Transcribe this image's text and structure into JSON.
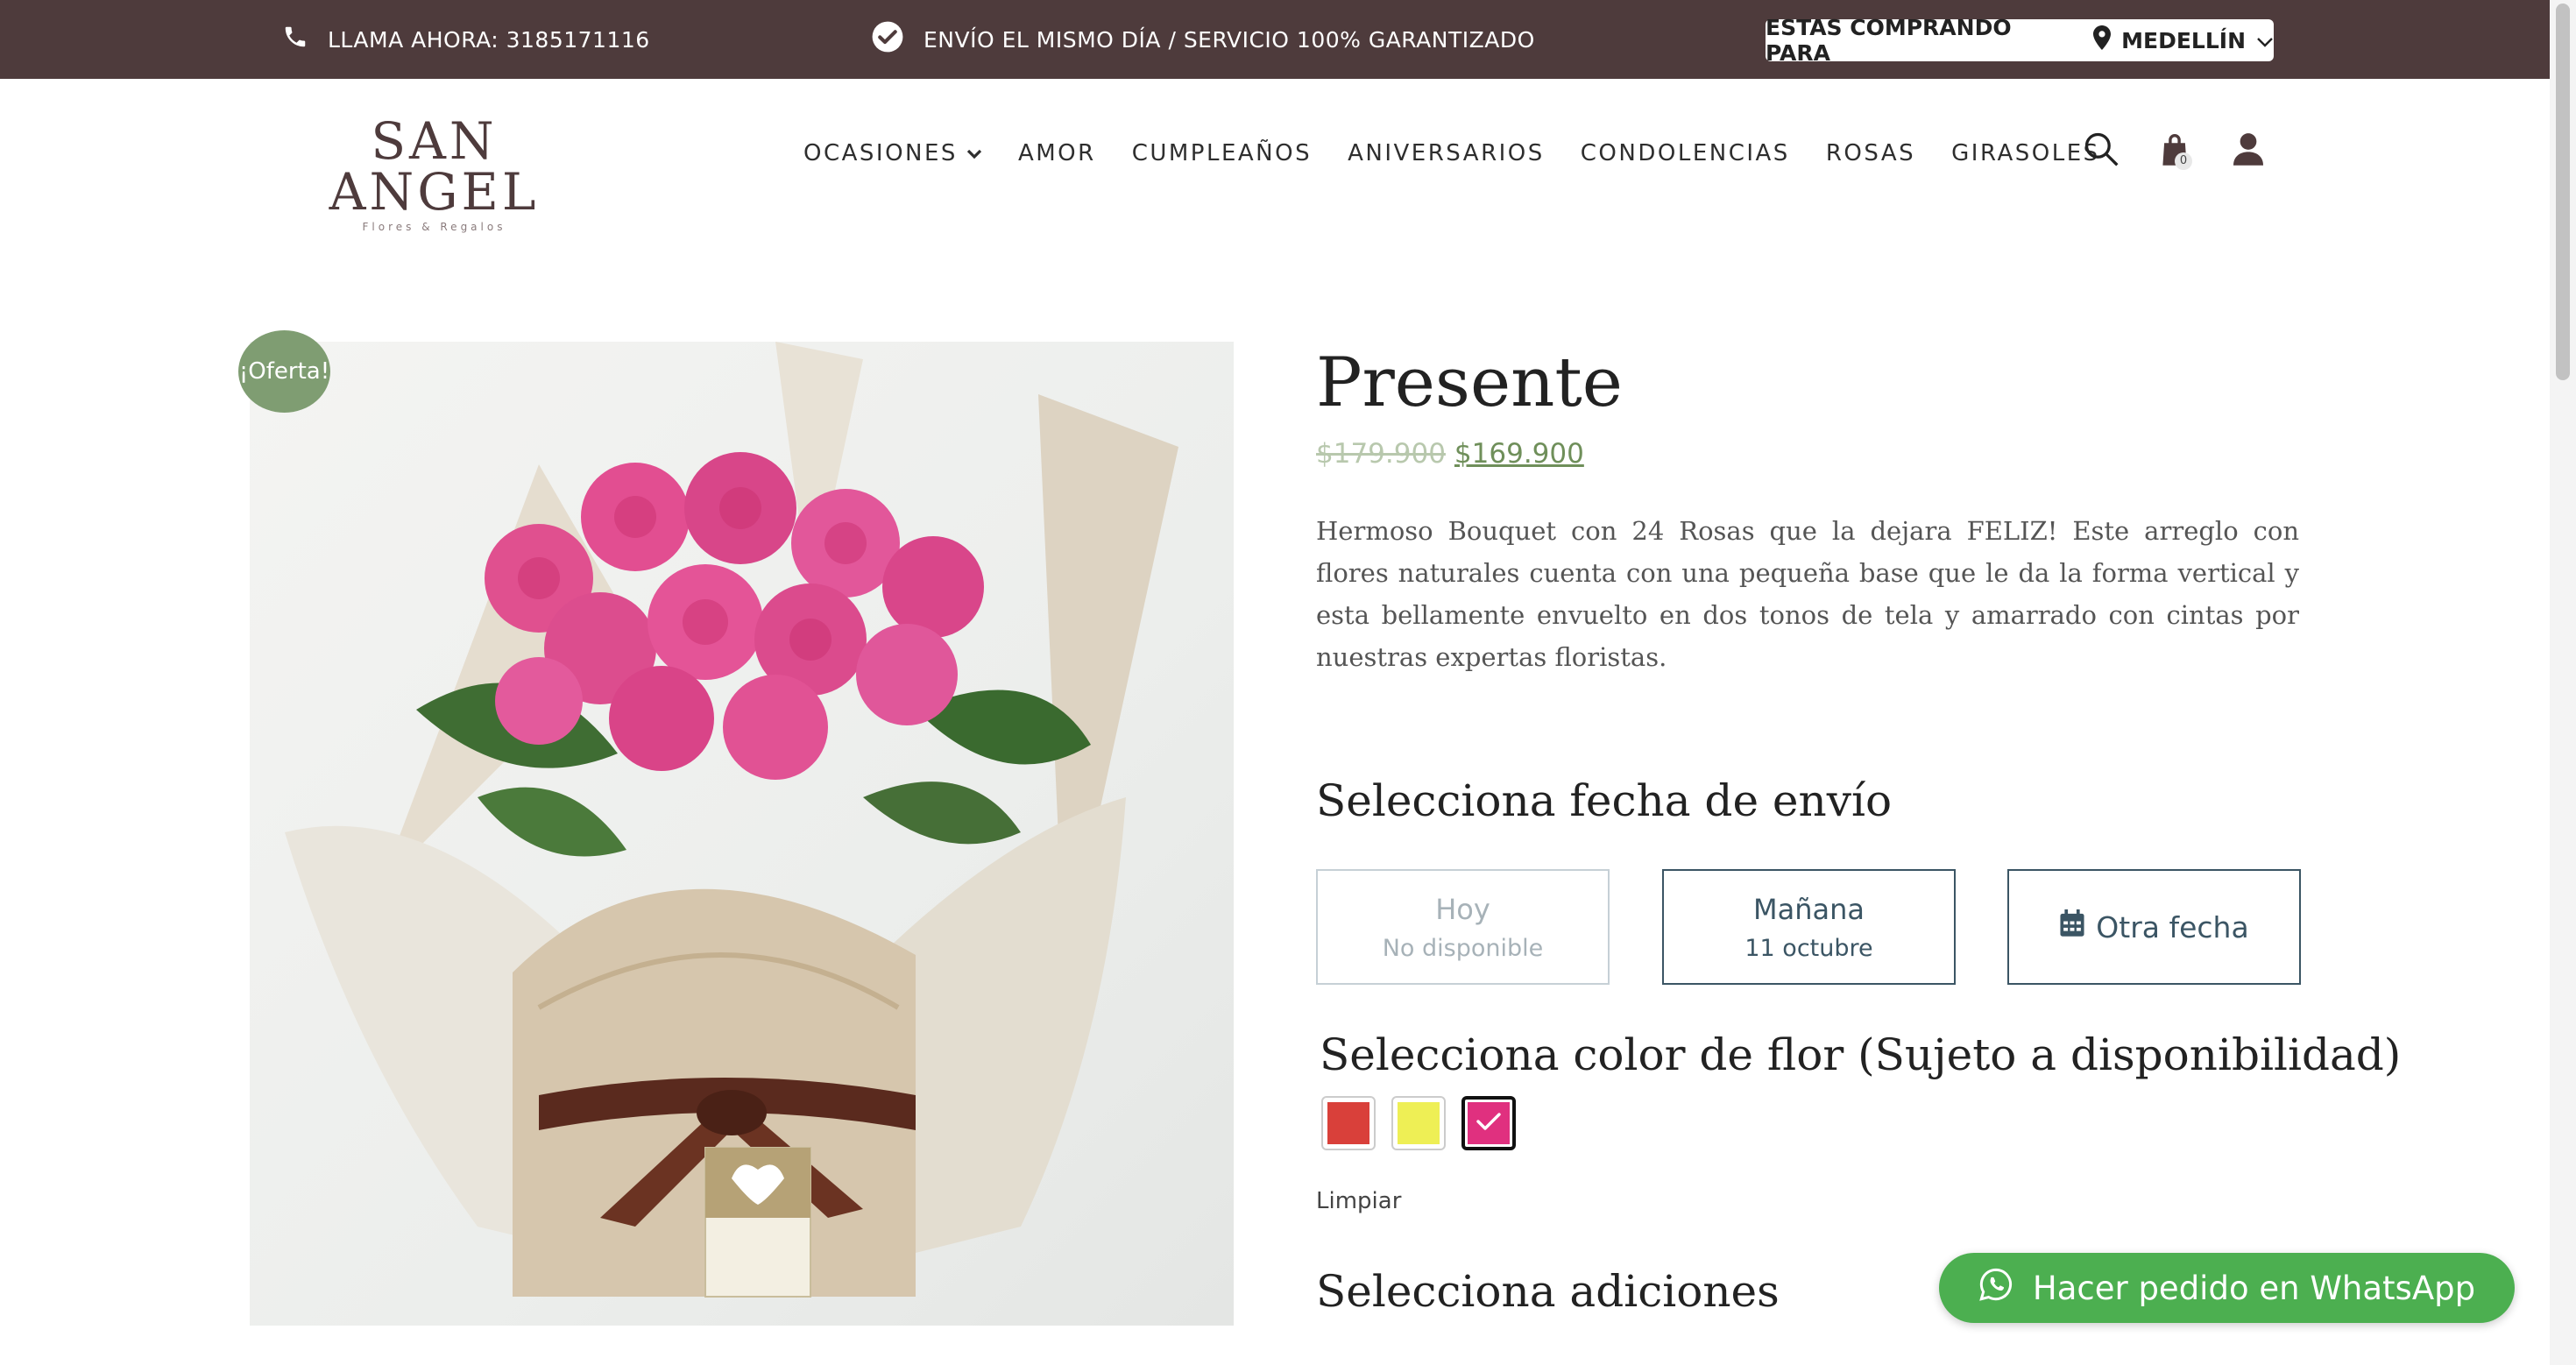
{
  "topbar": {
    "call_label": "LLAMA AHORA: 3185171116",
    "ship_label": "ENVÍO EL MISMO DÍA / SERVICIO 100% GARANTIZADO",
    "city_prefix": "ESTAS COMPRANDO PARA",
    "city_name": "MEDELLÍN"
  },
  "brand": {
    "name": "SAN ANGEL",
    "tagline": "Flores & Regalos"
  },
  "nav": {
    "items": [
      "OCASIONES",
      "AMOR",
      "CUMPLEAÑOS",
      "ANIVERSARIOS",
      "CONDOLENCIAS",
      "ROSAS",
      "GIRASOLES"
    ]
  },
  "header": {
    "cart_count": "0"
  },
  "product": {
    "badge": "¡Oferta!",
    "title": "Presente",
    "old_price": "$179.900",
    "new_price": "$169.900",
    "description": "Hermoso Bouquet con 24 Rosas que la dejara FELIZ! Este arreglo con flores naturales cuenta con una pequeña base que le da la forma vertical y esta bellamente envuelto en dos tonos de tela y amarrado con cintas por nuestras expertas floristas.",
    "image_alt": "Bouquet de rosas rosadas envuelto en papel"
  },
  "delivery": {
    "title": "Selecciona fecha de envío",
    "options": [
      {
        "label": "Hoy",
        "sub": "No disponible",
        "state": "disabled"
      },
      {
        "label": "Mañana",
        "sub": "11 octubre",
        "state": "available"
      },
      {
        "label": "Otra fecha",
        "icon": "calendar-icon",
        "state": "available"
      }
    ]
  },
  "color": {
    "title": "Selecciona color de flor (Sujeto a disponibilidad)",
    "swatches": [
      {
        "name": "red",
        "hex": "#d9403a",
        "selected": false
      },
      {
        "name": "yellow",
        "hex": "#eeef55",
        "selected": false
      },
      {
        "name": "pink",
        "hex": "#e0307f",
        "selected": true
      }
    ],
    "clear_label": "Limpiar"
  },
  "additions": {
    "title": "Selecciona adiciones"
  },
  "whatsapp": {
    "label": "Hacer pedido en WhatsApp"
  },
  "colors": {
    "topbar": "#4e3b3c",
    "sale": "#7f9d72",
    "price": "#6f8f5a",
    "whatsapp": "#4caf50",
    "accent": "#3b5564"
  }
}
